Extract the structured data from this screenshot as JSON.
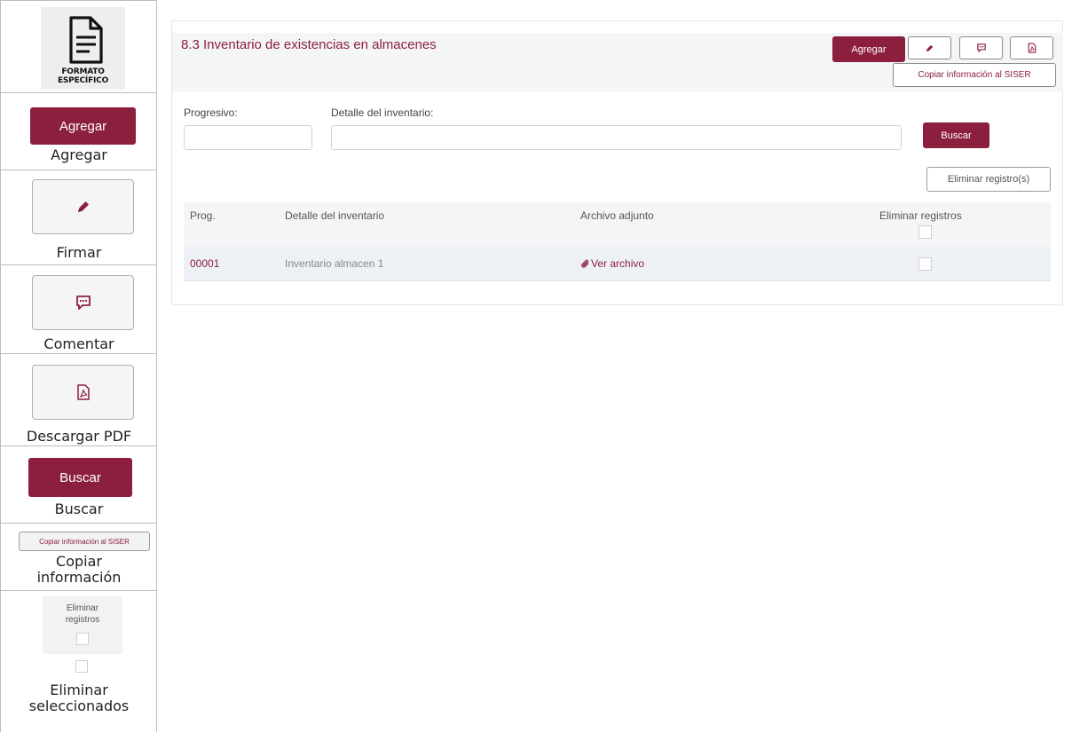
{
  "legend": {
    "logo": {
      "line1": "FORMATO",
      "line2": "ESPECÍFICO"
    },
    "agregar": {
      "button": "Agregar",
      "caption": "Agregar"
    },
    "firmar": {
      "caption": "Firmar",
      "icon": "pen-icon"
    },
    "comentar": {
      "caption": "Comentar",
      "icon": "comment-icon"
    },
    "pdf": {
      "caption": "Descargar PDF",
      "icon": "pdf-icon"
    },
    "buscar": {
      "button": "Buscar",
      "caption": "Buscar"
    },
    "copiar": {
      "button": "Copiar información al SISER",
      "caption_line1": "Copiar",
      "caption_line2": "información"
    },
    "eliminar": {
      "card_line1": "Eliminar",
      "card_line2": "registros",
      "caption_line1": "Eliminar",
      "caption_line2": "seleccionados"
    }
  },
  "panel": {
    "title": "8.3 Inventario de existencias en almacenes",
    "add_label": "Agregar",
    "copy_label": "Copiar información al SISER",
    "filters": {
      "progresivo_label": "Progresivo:",
      "progresivo_value": "",
      "detalle_label": "Detalle del inventario:",
      "detalle_value": ""
    },
    "search_label": "Buscar",
    "delete_label": "Eliminar registro(s)",
    "table": {
      "headers": [
        "Prog.",
        "Detalle del inventario",
        "Archivo adjunto",
        "Eliminar registros"
      ],
      "rows": [
        {
          "prog": "00001",
          "detalle": "Inventario almacen 1",
          "archivo": "Ver archivo"
        }
      ]
    }
  },
  "colors": {
    "brand": "#8c1f3e",
    "header_bg": "#f4f5f7",
    "row_bg": "#edf0f4"
  }
}
